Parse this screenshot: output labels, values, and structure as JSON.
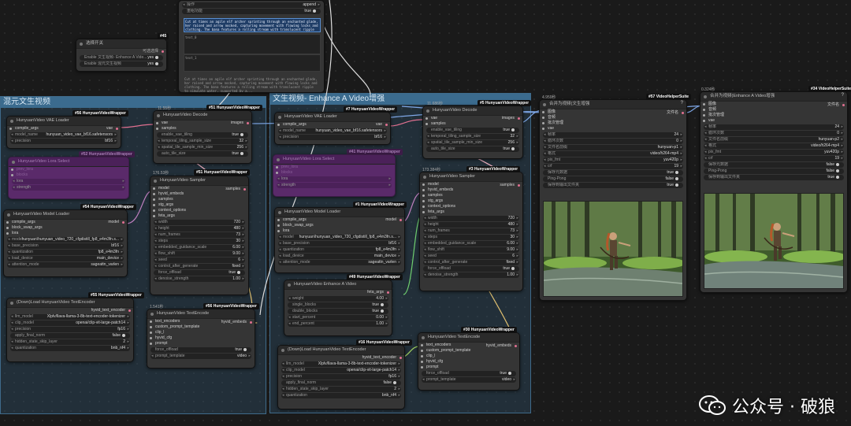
{
  "top_node": {
    "row1_k": "操作",
    "row1_v": "append",
    "row2_k": "重组功能",
    "row2_v": "true",
    "sel_text": "Cut at times an agile elf archer sprinting through an enchanted glade, her raised and arrow nocked, capturing movement with flowing locks and clothing. The bana features a rolling stream with translucent ripple to simulate water, supported by a...",
    "box1": "text_0",
    "box2": "text_1",
    "bottom_text": "Cut at times an agile elf archer sprinting through an enchanted glade, her raised and arrow nocked, capturing movement with flowing locks and clothing. The bana features a rolling stream with translucent ripple to simulate water, supported by a..."
  },
  "switch_node": {
    "badge": "#45",
    "title": "选择开关",
    "sub": "可选选择",
    "opt1": "Enable 文生视频- Enhance A Vide...",
    "opt1_v": "yes",
    "opt2": "Enable 混元文生视频",
    "opt2_v": "yes"
  },
  "group_left": {
    "title": "混元文生视频"
  },
  "group_mid": {
    "title": "文生视频- Enhance A Video增强"
  },
  "vae_left": {
    "badge": "#56 HunyuanVideoWrapper",
    "title": "HunyuanVideo VAE Loader",
    "in1": "compile_args",
    "out1": "vae",
    "w1_k": "model_name",
    "w1_v": "hunyuan_video_vae_bf16.safetensors",
    "w2_k": "precision",
    "w2_v": "bf16"
  },
  "decode_left": {
    "time": "11.55秒",
    "badge": "#51 HunyuanVideoWrapper",
    "title": "HunyuanVideo Decode",
    "in1": "vae",
    "in2": "samples",
    "out1": "images",
    "w1_k": "enable_vae_tiling",
    "w1_v": "true",
    "w2_k": "temporal_tiling_sample_size",
    "w2_v": "32",
    "w3_k": "spatial_tile_sample_min_size",
    "w3_v": "256",
    "w4_k": "auto_tile_size",
    "w4_v": "true"
  },
  "purple_left": {
    "badge": "#52 HunyuanVideoWrapper",
    "title": "HunyuanVideo Lora Select",
    "l1": "prev_lora",
    "l2": "blocks",
    "l3": "lora",
    "l4": "strength"
  },
  "sampler_left": {
    "time": "176.53秒",
    "badge": "#53 HunyuanVideoWrapper",
    "title": "HunyuanVideo Sampler",
    "inputs": [
      "model",
      "hyvid_embeds",
      "samples",
      "stg_args",
      "context_options",
      "feta_args"
    ],
    "out1": "samples",
    "widgets": [
      [
        "width",
        "720"
      ],
      [
        "height",
        "480"
      ],
      [
        "num_frames",
        "73"
      ],
      [
        "steps",
        "30"
      ],
      [
        "embedded_guidance_scale",
        "6.00"
      ],
      [
        "flow_shift",
        "9.00"
      ],
      [
        "seed",
        "6"
      ],
      [
        "control_after_generate",
        "fixed"
      ],
      [
        "force_offload",
        "true"
      ],
      [
        "denoise_strength",
        "1.00"
      ]
    ]
  },
  "model_left": {
    "badge": "#54 HunyuanVideoWrapper",
    "title": "HunyuanVideo Model Loader",
    "in1": "compile_args",
    "in2": "block_swap_args",
    "in3": "lora",
    "out1": "model",
    "widgets": [
      [
        "model",
        "hunyuan\\hunyuan_video_720_cfgdistill_fp8_e4m3fn.s..."
      ],
      [
        "base_precision",
        "bf16"
      ],
      [
        "quantization",
        "fp8_e4m3fn"
      ],
      [
        "load_device",
        "main_device"
      ],
      [
        "attention_mode",
        "sageattn_varlen"
      ]
    ]
  },
  "dl_left": {
    "badge": "#55 HunyuanVideoWrapper",
    "title": "(Down)Load HunyuanVideo TextEncoder",
    "out1": "hyvid_text_encoder",
    "widgets": [
      [
        "llm_model",
        "Xlplv/llava-llama-3-8b-text-encoder-tokenizer"
      ],
      [
        "clip_model",
        "openai/clip-vit-large-patch14"
      ],
      [
        "precision",
        "fp16"
      ],
      [
        "apply_final_norm",
        "false"
      ],
      [
        "hidden_state_skip_layer",
        "2"
      ],
      [
        "quantization",
        "bnb_nf4"
      ]
    ]
  },
  "enc_left": {
    "time": "1.541秒",
    "badge": "#56 HunyuanVideoWrapper",
    "title": "HunyuanVideo TextEncode",
    "inputs": [
      "text_encoders",
      "custom_prompt_template",
      "clip_l",
      "hyvid_cfg",
      "prompt"
    ],
    "out1": "hyvid_embeds",
    "w1_k": "force_offload",
    "w1_v": "true",
    "w2_k": "prompt_template",
    "w2_v": "video"
  },
  "vae_mid": {
    "badge": "#7 HunyuanVideoWrapper",
    "title": "HunyuanVideo VAE Loader",
    "in1": "compile_args",
    "out1": "vae",
    "w1_k": "model_name",
    "w1_v": "hunyuan_video_vae_bf16.safetensors",
    "w2_k": "precision",
    "w2_v": "bf16"
  },
  "decode_mid": {
    "time": "11.686秒",
    "badge": "#5 HunyuanVideoWrapper",
    "title": "HunyuanVideo Decode",
    "in1": "vae",
    "in2": "samples",
    "out1": "images",
    "w1_k": "enable_vae_tiling",
    "w1_v": "true",
    "w2_k": "temporal_tiling_sample_size",
    "w2_v": "32",
    "w3_k": "spatial_tile_sample_min_size",
    "w3_v": "256",
    "w4_k": "auto_tile_size",
    "w4_v": "true"
  },
  "purple_mid": {
    "badge": "#41 HunyuanVideoWrapper",
    "title": "HunyuanVideo Lora Select",
    "l1": "prev_lora",
    "l2": "blocks",
    "l3": "lora",
    "l4": "strength"
  },
  "sampler_mid": {
    "time": "173.384秒",
    "badge": "#3 HunyuanVideoWrapper",
    "title": "HunyuanVideo Sampler",
    "inputs": [
      "model",
      "hyvid_embeds",
      "samples",
      "stg_args",
      "context_options",
      "feta_args"
    ],
    "out1": "samples",
    "widgets": [
      [
        "width",
        "720"
      ],
      [
        "height",
        "480"
      ],
      [
        "num_frames",
        "73"
      ],
      [
        "steps",
        "30"
      ],
      [
        "embedded_guidance_scale",
        "6.00"
      ],
      [
        "flow_shift",
        "9.00"
      ],
      [
        "seed",
        "6"
      ],
      [
        "control_after_generate",
        "fixed"
      ],
      [
        "force_offload",
        "true"
      ],
      [
        "denoise_strength",
        "1.00"
      ]
    ]
  },
  "model_mid": {
    "badge": "#1 HunyuanVideoWrapper",
    "title": "HunyuanVideo Model Loader",
    "in1": "compile_args",
    "in2": "block_swap_args",
    "in3": "lora",
    "out1": "model",
    "widgets": [
      [
        "model",
        "hunyuan\\hunyuan_video_720_cfgdistill_fp8_e4m3fn.s..."
      ],
      [
        "base_precision",
        "bf16"
      ],
      [
        "quantization",
        "fp8_e4m3fn"
      ],
      [
        "load_device",
        "main_device"
      ],
      [
        "attention_mode",
        "sageattn_varlen"
      ]
    ]
  },
  "enhance_mid": {
    "badge": "#49 HunyuanVideoWrapper",
    "title": "HunyuanVideo Enhance A Video",
    "out1": "feta_args",
    "widgets": [
      [
        "weight",
        "4.00"
      ],
      [
        "single_blocks",
        "true"
      ],
      [
        "double_blocks",
        "true"
      ],
      [
        "start_percent",
        "0.00"
      ],
      [
        "end_percent",
        "1.00"
      ]
    ]
  },
  "dl_mid": {
    "badge": "#16 HunyuanVideoWrapper",
    "title": "(Down)Load HunyuanVideo TextEncoder",
    "out1": "hyvid_text_encoder",
    "widgets": [
      [
        "llm_model",
        "Xlplv/llava-llama-3-8b-text-encoder-tokenizer"
      ],
      [
        "clip_model",
        "openai/clip-vit-large-patch14"
      ],
      [
        "precision",
        "fp16"
      ],
      [
        "apply_final_norm",
        "false"
      ],
      [
        "hidden_state_skip_layer",
        "2"
      ],
      [
        "quantization",
        "bnb_nf4"
      ]
    ]
  },
  "enc_mid": {
    "badge": "#30 HunyuanVideoWrapper",
    "title": "HunyuanVideo TextEncode",
    "inputs": [
      "text_encoders",
      "custom_prompt_template",
      "clip_l",
      "hyvid_cfg",
      "prompt"
    ],
    "out1": "hyvid_embeds",
    "w1_k": "force_offload",
    "w1_v": "true",
    "w2_k": "prompt_template",
    "w2_v": "video"
  },
  "combine1": {
    "time": "4.959秒",
    "badge": "#57 VideoHelperSuite",
    "title": "合并为视频(文生增强",
    "inputs": [
      "图像",
      "音频",
      "批次管理",
      "vae"
    ],
    "out1": "文件名",
    "widgets": [
      [
        "帧率",
        "24"
      ],
      [
        "循环次数",
        "0"
      ],
      [
        "文件名前缀",
        "hunyuan-p1"
      ],
      [
        "格式",
        "video/h264-mp4"
      ],
      [
        "pix_fmt",
        "yuv420p"
      ],
      [
        "crf",
        "19"
      ],
      [
        "保存元数据",
        "true"
      ],
      [
        "Ping-Pong",
        "false"
      ],
      [
        "保存到输出文件夹",
        "true"
      ]
    ]
  },
  "combine2": {
    "time": "0.324秒",
    "badge": "#34 VideoHelperSuite",
    "title": "合并为视频(Enhance A Video增强",
    "inputs": [
      "图像",
      "音频",
      "批次管理",
      "vae"
    ],
    "out1": "文件名",
    "widgets": [
      [
        "帧率",
        "24"
      ],
      [
        "循环次数",
        "0"
      ],
      [
        "文件名前缀",
        "hunyuan-p2"
      ],
      [
        "格式",
        "video/h264-mp4"
      ],
      [
        "pix_fmt",
        "yuv420p"
      ],
      [
        "crf",
        "19"
      ],
      [
        "保存元数据",
        "false"
      ],
      [
        "Ping-Pong",
        "false"
      ],
      [
        "保存到输出文件夹",
        "true"
      ]
    ]
  },
  "watermark": {
    "text": "公众号 · 破狼"
  },
  "colors": {
    "accent": "#3b6b8e",
    "wire_blue": "#7fa8e8",
    "wire_green": "#6fcf6f",
    "wire_white": "#dddddd",
    "lora_purple": "#5a2a6a"
  }
}
